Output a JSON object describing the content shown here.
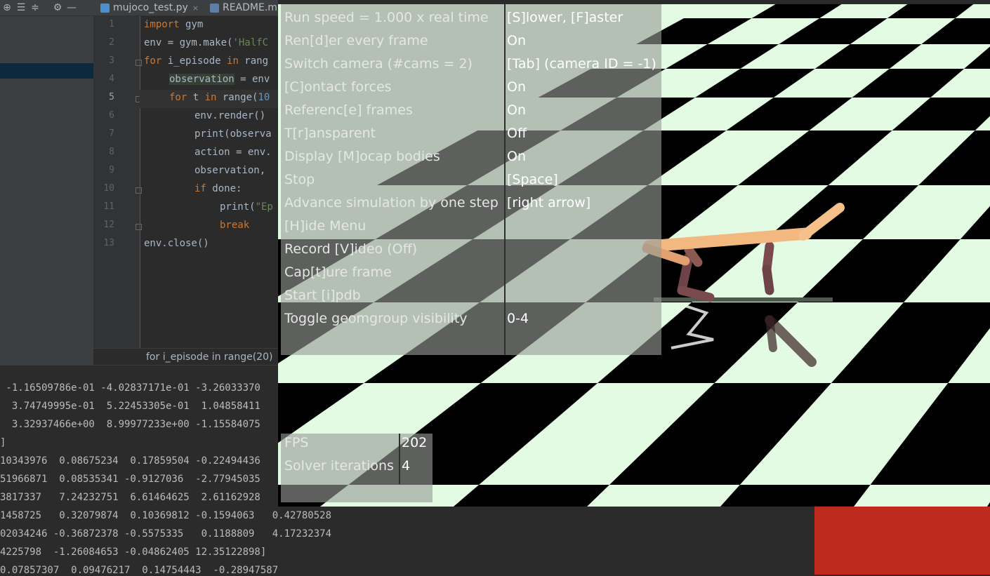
{
  "ide": {
    "tabs": [
      {
        "label": "mujoco_test.py",
        "icon": "python-file-icon",
        "close": "×",
        "color": "#4a8fd0"
      },
      {
        "label": "README.m",
        "icon": "markdown-file-icon",
        "color": "#5a7fa8"
      }
    ],
    "toolbar_icons": [
      "crosshair-icon",
      "expand-all-icon",
      "collapse-all-icon",
      "gear-icon",
      "minimize-icon"
    ],
    "line_numbers": [
      "1",
      "2",
      "3",
      "4",
      "5",
      "6",
      "7",
      "8",
      "9",
      "10",
      "11",
      "12",
      "13"
    ],
    "code": {
      "l1_kw": "import",
      "l1_rest": " gym",
      "l2_a": "env = gym.make(",
      "l2_str": "'HalfC",
      "l3_kw": "for",
      "l3_b": " i_episode ",
      "l3_kw2": "in",
      "l3_c": " rang",
      "l4_hl": "observation",
      "l4_rest": " = env",
      "l5_kw": "for",
      "l5_b": " t ",
      "l5_kw2": "in",
      "l5_c": " range(",
      "l5_num": "10",
      "l6": "env.render()",
      "l7": "print(observa",
      "l8": "action = env.",
      "l9": "observation, ",
      "l10_kw": "if",
      "l10_rest": " done:",
      "l11_a": "print(",
      "l11_str": "\"Ep",
      "l12_kw": "break",
      "l13": "env.close()"
    },
    "breadcrumb": "for i_episode in range(20)",
    "console_lines": [
      " -1.16509786e-01 -4.02837171e-01 -3.26033370",
      "  3.74749995e-01  5.22453305e-01  1.04858411",
      "  3.32937466e+00  8.99977233e+00 -1.15584075",
      "]",
      "10343976  0.08675234  0.17859504 -0.22494436",
      "51966871  0.08535341 -0.9127036  -2.77945035",
      "3817337   7.24232751  6.61464625  2.61162928",
      "1458725   0.32079874  0.10369812 -0.1594063   0.42780528",
      "02034246 -0.36872378 -0.5575335   0.1188809   4.17232374",
      "4225798  -1.26084653 -0.04862405 12.35122898]",
      "0.07857307  0.09476217  0.14754443  -0.28947587"
    ]
  },
  "viewer": {
    "menu": [
      {
        "label": "Run speed = 1.000 x real time",
        "value": "[S]lower, [F]aster"
      },
      {
        "label": "Ren[d]er every frame",
        "value": "On"
      },
      {
        "label": "Switch camera (#cams = 2)",
        "value": "[Tab] (camera ID = -1)"
      },
      {
        "label": "[C]ontact forces",
        "value": "On"
      },
      {
        "label": "Referenc[e] frames",
        "value": "On"
      },
      {
        "label": "T[r]ansparent",
        "value": "Off"
      },
      {
        "label": "Display [M]ocap bodies",
        "value": "On"
      },
      {
        "label": "Stop",
        "value": "[Space]"
      },
      {
        "label": "Advance simulation by one step",
        "value": "[right arrow]"
      },
      {
        "label": "[H]ide Menu",
        "value": ""
      },
      {
        "label": "Record [V]ideo (Off)",
        "value": ""
      },
      {
        "label": "Cap[t]ure frame",
        "value": ""
      },
      {
        "label": "Start [i]pdb",
        "value": ""
      },
      {
        "label": "Toggle geomgroup visibility",
        "value": "0-4"
      }
    ],
    "stats": [
      {
        "label": "FPS",
        "value": "202"
      },
      {
        "label": "Solver iterations",
        "value": "4"
      }
    ],
    "colors": {
      "checker_light": "#e2fbe2",
      "checker_dark": "#000000",
      "torso": "#f2b880",
      "leg": "#7a4a4e"
    }
  }
}
